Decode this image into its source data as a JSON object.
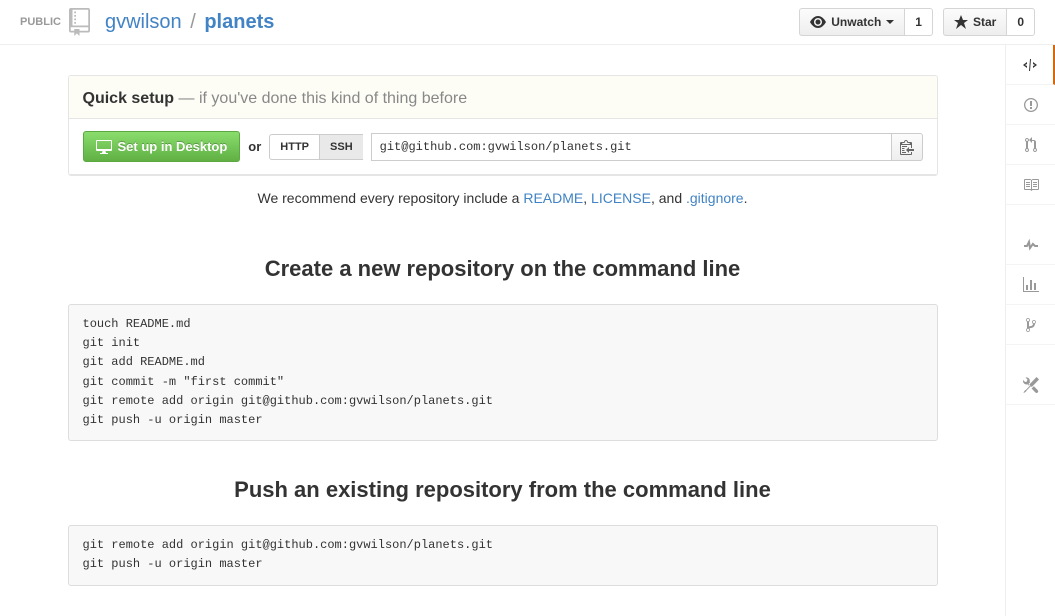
{
  "header": {
    "visibility": "PUBLIC",
    "owner": "gvwilson",
    "separator": "/",
    "repo": "planets",
    "unwatch_label": "Unwatch",
    "watch_count": "1",
    "star_label": "Star",
    "star_count": "0"
  },
  "quick_setup": {
    "title_strong": "Quick setup",
    "title_rest": " — if you've done this kind of thing before",
    "desktop_button": "Set up in Desktop",
    "or_label": "or",
    "http_label": "HTTP",
    "ssh_label": "SSH",
    "clone_url": "git@github.com:gvwilson/planets.git"
  },
  "recommend": {
    "prefix": "We recommend every repository include a ",
    "readme": "README",
    "comma1": ", ",
    "license": "LICENSE",
    "comma2": ", and ",
    "gitignore": ".gitignore",
    "suffix": "."
  },
  "create_section": {
    "title": "Create a new repository on the command line",
    "code": "touch README.md\ngit init\ngit add README.md\ngit commit -m \"first commit\"\ngit remote add origin git@github.com:gvwilson/planets.git\ngit push -u origin master"
  },
  "push_section": {
    "title": "Push an existing repository from the command line",
    "code": "git remote add origin git@github.com:gvwilson/planets.git\ngit push -u origin master"
  }
}
